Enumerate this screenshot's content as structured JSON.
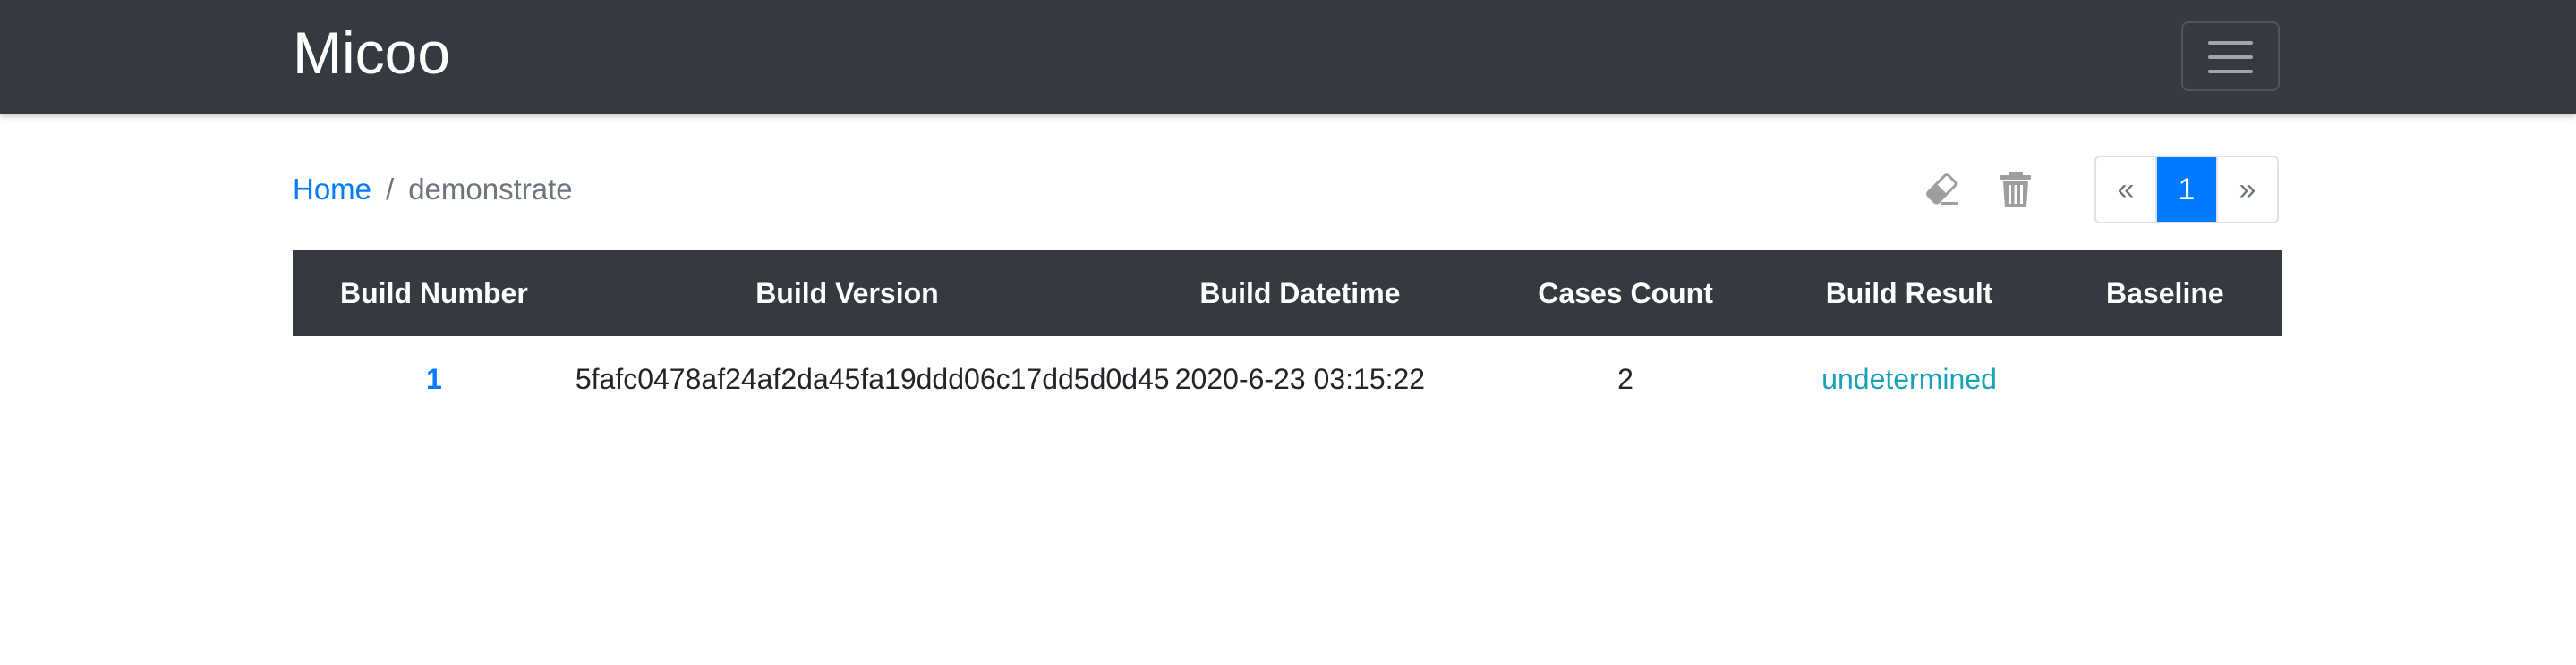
{
  "navbar": {
    "brand": "Micoo",
    "toggler_icon": "hamburger-icon"
  },
  "breadcrumb": {
    "home": "Home",
    "separator": "/",
    "current": "demonstrate"
  },
  "toolbar": {
    "clean_icon": "eraser-icon",
    "delete_icon": "trash-icon"
  },
  "pagination": {
    "prev": "«",
    "current_page": "1",
    "next": "»"
  },
  "table": {
    "headers": [
      "Build Number",
      "Build Version",
      "Build Datetime",
      "Cases Count",
      "Build Result",
      "Baseline"
    ],
    "rows": [
      {
        "build_number": "1",
        "build_version": "5fafc0478af24af2da45fa19ddd06c17dd5d0d45",
        "build_datetime": "2020-6-23 03:15:22",
        "cases_count": "2",
        "build_result": "undetermined",
        "baseline": ""
      }
    ]
  },
  "colors": {
    "navbar_bg": "#343a40",
    "link": "#007bff",
    "result_info": "#17a2b8",
    "icon_gray": "#9e9e9e"
  }
}
